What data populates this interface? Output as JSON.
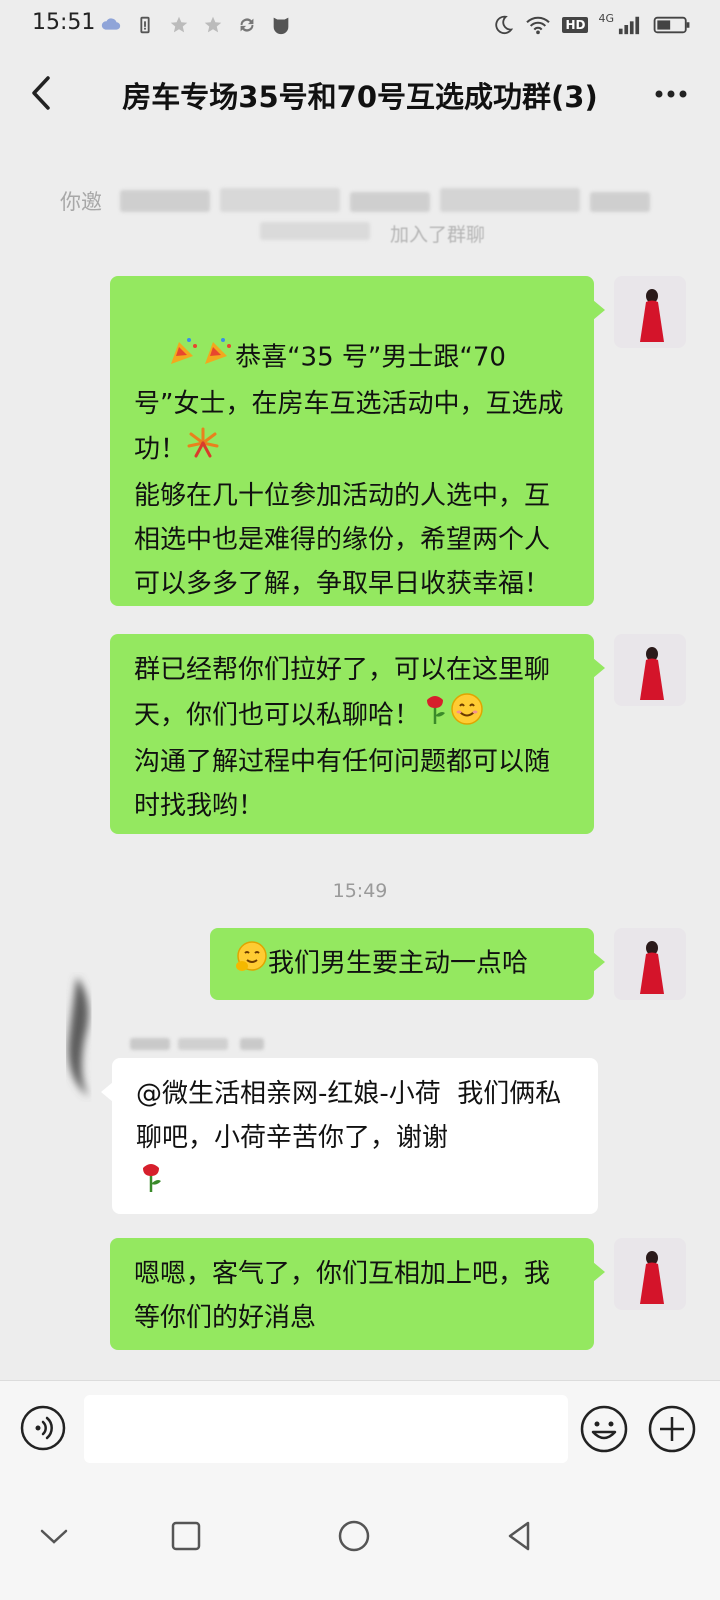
{
  "status_bar": {
    "time": "15:51",
    "network": "4G",
    "hd": "HD"
  },
  "header": {
    "title": "房车专场35号和70号互选成功群(3)"
  },
  "system_notice": {
    "prefix": "你邀",
    "suffix": "加入了群聊"
  },
  "messages": [
    {
      "text": "恭喜“35 号”男士跟“70 号”女士，在房车互选活动中，互选成功！"
    },
    {
      "text": "能够在几十位参加活动的人选中，互相选中也是难得的缘份，希望两个人可以多多了解，争取早日收获幸福！"
    },
    {
      "text": "群已经帮你们拉好了，可以在这里聊天，你们也可以私聊哈！"
    },
    {
      "text": "沟通了解过程中有任何问题都可以随时找我哟！"
    },
    {
      "text": "我们男生要主动一点哈"
    },
    {
      "text": "@微生活相亲网-红娘-小荷  我们俩私聊吧，小荷辛苦你了，谢谢"
    },
    {
      "text": "嗯嗯，客气了，你们互相加上吧，我等你们的好消息"
    }
  ],
  "timestamp": "15:49",
  "colors": {
    "bubble_green": "#94e860",
    "background": "#ededed",
    "bubble_white": "#ffffff"
  }
}
